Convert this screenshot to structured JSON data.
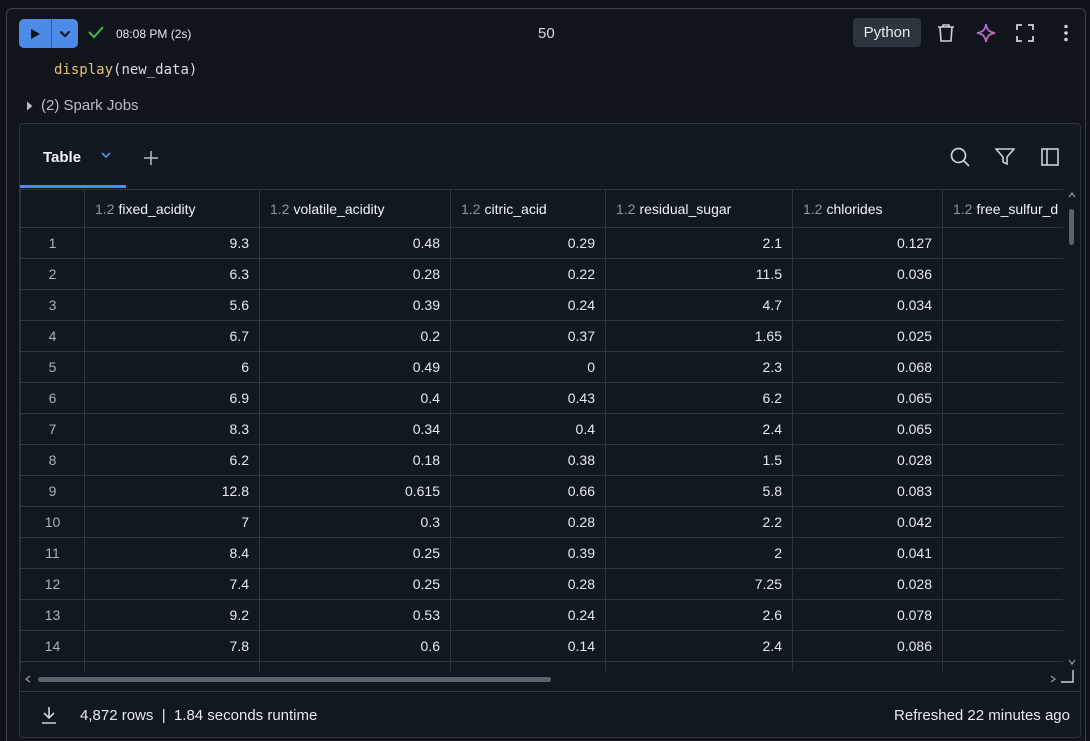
{
  "toolbar": {
    "exec_time": "08:08 PM (2s)",
    "center_count": "50",
    "language": "Python"
  },
  "code": {
    "fn": "display",
    "arg": "new_data"
  },
  "spark_jobs": "(2) Spark Jobs",
  "results": {
    "tab_label": "Table",
    "columns": [
      {
        "type": "1.2",
        "name": "fixed_acidity"
      },
      {
        "type": "1.2",
        "name": "volatile_acidity"
      },
      {
        "type": "1.2",
        "name": "citric_acid"
      },
      {
        "type": "1.2",
        "name": "residual_sugar"
      },
      {
        "type": "1.2",
        "name": "chlorides"
      },
      {
        "type": "1.2",
        "name": "free_sulfur_d"
      }
    ],
    "rows": [
      [
        "1",
        "9.3",
        "0.48",
        "0.29",
        "2.1",
        "0.127",
        ""
      ],
      [
        "2",
        "6.3",
        "0.28",
        "0.22",
        "11.5",
        "0.036",
        ""
      ],
      [
        "3",
        "5.6",
        "0.39",
        "0.24",
        "4.7",
        "0.034",
        ""
      ],
      [
        "4",
        "6.7",
        "0.2",
        "0.37",
        "1.65",
        "0.025",
        ""
      ],
      [
        "5",
        "6",
        "0.49",
        "0",
        "2.3",
        "0.068",
        ""
      ],
      [
        "6",
        "6.9",
        "0.4",
        "0.43",
        "6.2",
        "0.065",
        ""
      ],
      [
        "7",
        "8.3",
        "0.34",
        "0.4",
        "2.4",
        "0.065",
        ""
      ],
      [
        "8",
        "6.2",
        "0.18",
        "0.38",
        "1.5",
        "0.028",
        ""
      ],
      [
        "9",
        "12.8",
        "0.615",
        "0.66",
        "5.8",
        "0.083",
        ""
      ],
      [
        "10",
        "7",
        "0.3",
        "0.28",
        "2.2",
        "0.042",
        ""
      ],
      [
        "11",
        "8.4",
        "0.25",
        "0.39",
        "2",
        "0.041",
        ""
      ],
      [
        "12",
        "7.4",
        "0.25",
        "0.28",
        "7.25",
        "0.028",
        ""
      ],
      [
        "13",
        "9.2",
        "0.53",
        "0.24",
        "2.6",
        "0.078",
        ""
      ],
      [
        "14",
        "7.8",
        "0.6",
        "0.14",
        "2.4",
        "0.086",
        ""
      ],
      [
        "",
        "",
        "",
        "",
        "",
        "",
        ""
      ]
    ],
    "footer": {
      "rows_info": "4,872 rows  |  1.84 seconds runtime",
      "refreshed": "Refreshed 22 minutes ago"
    }
  },
  "icons": {
    "run": "play-icon",
    "run_menu": "chevron-down-icon",
    "status": "check-icon",
    "delete": "trash-icon",
    "assistant": "sparkle-icon",
    "expand": "fullscreen-icon",
    "more": "more-vertical-icon",
    "search": "search-icon",
    "filter": "filter-icon",
    "panel": "sidebar-panel-icon",
    "download": "download-icon"
  },
  "colors": {
    "accent": "#4c8ce8",
    "success": "#3fb950",
    "sparkle_start": "#c678dd",
    "sparkle_end": "#e06c75"
  }
}
